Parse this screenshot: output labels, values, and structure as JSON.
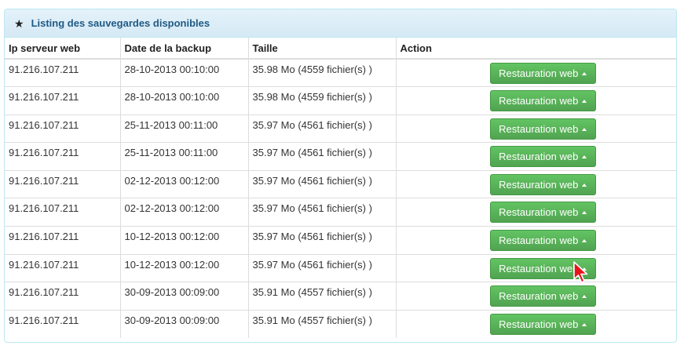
{
  "panel": {
    "icon": "star-icon",
    "title": "Listing des sauvegardes disponibles"
  },
  "table": {
    "headers": [
      "Ip serveur web",
      "Date de la backup",
      "Taille",
      "Action"
    ],
    "rows": [
      {
        "ip": "91.216.107.211",
        "date": "28-10-2013 00:10:00",
        "size": "35.98 Mo (4559 fichier(s) )",
        "action": "Restauration web"
      },
      {
        "ip": "91.216.107.211",
        "date": "28-10-2013 00:10:00",
        "size": "35.98 Mo (4559 fichier(s) )",
        "action": "Restauration web"
      },
      {
        "ip": "91.216.107.211",
        "date": "25-11-2013 00:11:00",
        "size": "35.97 Mo (4561 fichier(s) )",
        "action": "Restauration web"
      },
      {
        "ip": "91.216.107.211",
        "date": "25-11-2013 00:11:00",
        "size": "35.97 Mo (4561 fichier(s) )",
        "action": "Restauration web"
      },
      {
        "ip": "91.216.107.211",
        "date": "02-12-2013 00:12:00",
        "size": "35.97 Mo (4561 fichier(s) )",
        "action": "Restauration web"
      },
      {
        "ip": "91.216.107.211",
        "date": "02-12-2013 00:12:00",
        "size": "35.97 Mo (4561 fichier(s) )",
        "action": "Restauration web"
      },
      {
        "ip": "91.216.107.211",
        "date": "10-12-2013 00:12:00",
        "size": "35.97 Mo (4561 fichier(s) )",
        "action": "Restauration web"
      },
      {
        "ip": "91.216.107.211",
        "date": "10-12-2013 00:12:00",
        "size": "35.97 Mo (4561 fichier(s) )",
        "action": "Restauration web"
      },
      {
        "ip": "91.216.107.211",
        "date": "30-09-2013 00:09:00",
        "size": "35.91 Mo (4557 fichier(s) )",
        "action": "Restauration web"
      },
      {
        "ip": "91.216.107.211",
        "date": "30-09-2013 00:09:00",
        "size": "35.91 Mo (4557 fichier(s) )",
        "action": "Restauration web"
      }
    ]
  },
  "colors": {
    "button": "#5cb85c",
    "heading_text": "#1f5a84",
    "panel_border": "#bce8f1"
  }
}
